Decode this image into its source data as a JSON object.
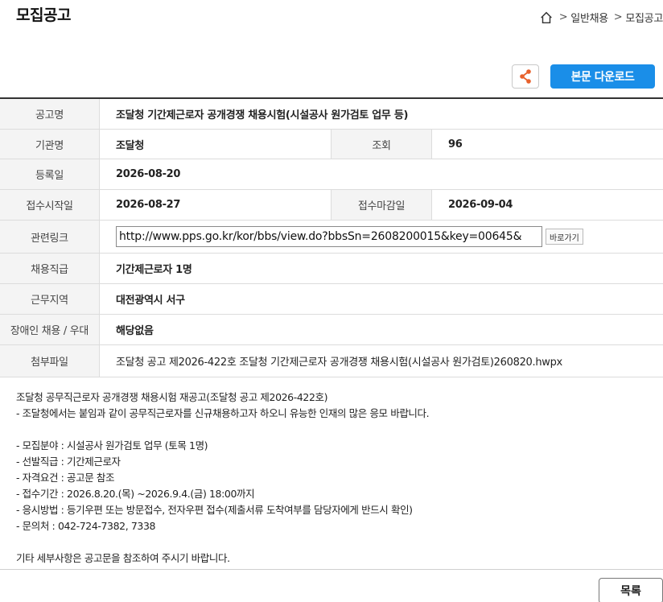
{
  "header": {
    "title": "모집공고",
    "breadcrumb": [
      "일반채용",
      "모집공고"
    ]
  },
  "toolbar": {
    "share_icon": "share-icon",
    "download_label": "본문 다운로드",
    "accent_color": "#1a8ee8"
  },
  "detail": {
    "title_label": "공고명",
    "title_value": "조달청 기간제근로자 공개경쟁 채용시험(시설공사 원가검토 업무 등)",
    "agency_label": "기관명",
    "agency_value": "조달청",
    "views_label": "조회",
    "views_value": "96",
    "reg_date_label": "등록일",
    "reg_date_value": "2026-08-20",
    "start_label": "접수시작일",
    "start_value": "2026-08-27",
    "end_label": "접수마감일",
    "end_value": "2026-09-04",
    "link_label": "관련링크",
    "link_value": "http://www.pps.go.kr/kor/bbs/view.do?bbsSn=2608200015&key=00645&",
    "goto_label": "바로가기",
    "rank_label": "채용직급",
    "rank_value": "기간제근로자 1명",
    "region_label": "근무지역",
    "region_value": "대전광역시 서구",
    "disabled_label": "장애인 채용 / 우대",
    "disabled_value": "해당없음",
    "attach_label": "첨부파일",
    "attach_value": "조달청 공고 제2026-422호 조달청 기간제근로자 공개경쟁 채용시험(시설공사 원가검토)260820.hwpx"
  },
  "body": {
    "lines": [
      "조달청 공무직근로자 공개경쟁 채용시험 재공고(조달청 공고 제2026-422호)",
      "- 조달청에서는 붙임과 같이 공무직근로자를 신규채용하고자 하오니 유능한 인재의 많은 응모 바랍니다.",
      "",
      "- 모집분야 : 시설공사 원가검토 업무 (토목 1명)",
      "- 선발직급 : 기간제근로자",
      "- 자격요건 : 공고문 참조",
      "- 접수기간 : 2026.8.20.(목) ~2026.9.4.(금) 18:00까지",
      "- 응시방법 : 등기우편 또는 방문접수, 전자우편 접수(제출서류 도착여부를 담당자에게 반드시 확인)",
      "- 문의처 : 042-724-7382, 7338",
      "",
      "기타 세부사항은 공고문을 참조하여 주시기 바랍니다."
    ]
  },
  "footer": {
    "list_label": "목록"
  }
}
